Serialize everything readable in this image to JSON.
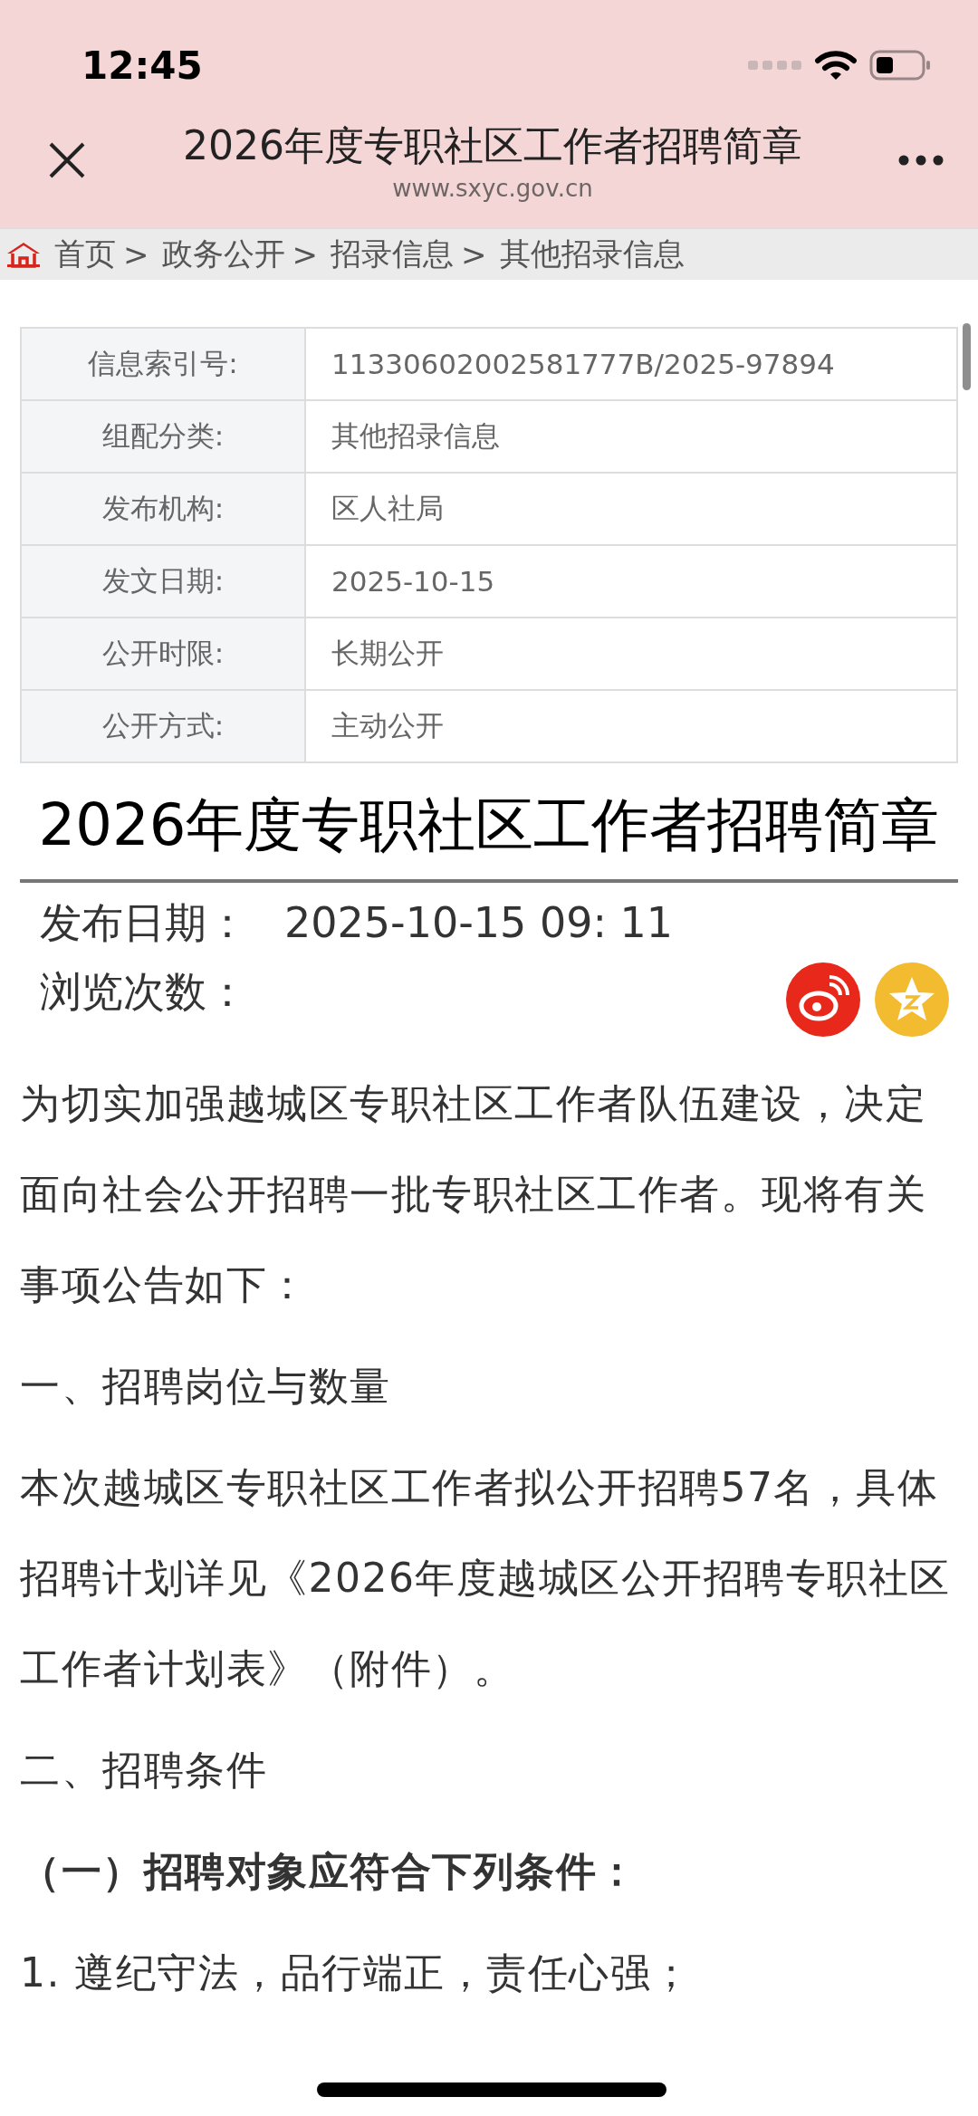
{
  "status_bar": {
    "time": "12:45"
  },
  "nav_bar": {
    "title": "2026年度专职社区工作者招聘简章",
    "url": "www.sxyc.gov.cn"
  },
  "breadcrumb": {
    "items": [
      "首页",
      "政务公开",
      "招录信息",
      "其他招录信息"
    ],
    "separators": [
      ">",
      ">",
      ">"
    ]
  },
  "info_table": {
    "rows": [
      {
        "label": "信息索引号:",
        "value": "11330602002581777B/2025-97894"
      },
      {
        "label": "组配分类:",
        "value": "其他招录信息"
      },
      {
        "label": "发布机构:",
        "value": "区人社局"
      },
      {
        "label": "发文日期:",
        "value": "2025-10-15"
      },
      {
        "label": "公开时限:",
        "value": "长期公开"
      },
      {
        "label": "公开方式:",
        "value": "主动公开"
      }
    ]
  },
  "article": {
    "title": "2026年度专职社区工作者招聘简章",
    "meta": [
      {
        "label": "发布日期：",
        "value": "2025-10-15 09: 11"
      },
      {
        "label": "浏览次数："
      }
    ],
    "paragraphs": [
      {
        "kind": "text",
        "text": "为切实加强越城区专职社区工作者队伍建设，决定面向社会公开招聘一批专职社区工作者。现将有关事项公告如下："
      },
      {
        "kind": "text",
        "text": "一、招聘岗位与数量"
      },
      {
        "kind": "text",
        "text": "本次越城区专职社区工作者拟公开招聘57名，具体招聘计划详见《2026年度越城区公开招聘专职社区工作者计划表》（附件）。"
      },
      {
        "kind": "text",
        "text": "二、招聘条件"
      },
      {
        "kind": "bold",
        "text": "（一）招聘对象应符合下列条件："
      },
      {
        "kind": "text",
        "text": "1. 遵纪守法，品行端正，责任心强；"
      }
    ]
  }
}
